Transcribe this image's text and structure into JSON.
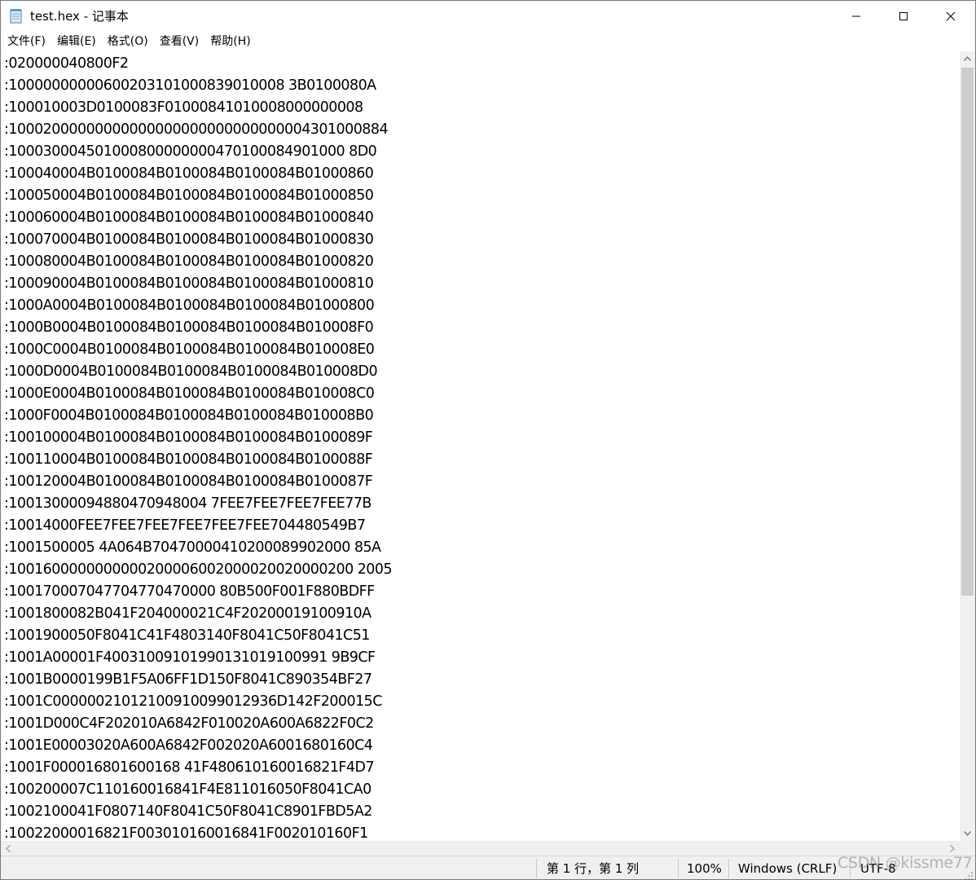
{
  "window": {
    "title": "test.hex - 记事本",
    "minimize_glyph": "—",
    "maximize_glyph": "□",
    "close_glyph": "✕"
  },
  "menu": {
    "items": [
      {
        "label": "文件(F)"
      },
      {
        "label": "编辑(E)"
      },
      {
        "label": "格式(O)"
      },
      {
        "label": "查看(V)"
      },
      {
        "label": "帮助(H)"
      }
    ]
  },
  "editor": {
    "lines": [
      ":020000040800F2",
      ":10000000000600203101000839010008 3B0100080A",
      ":100010003D0100083F01000841010008000000008",
      ":10002000000000000000000000000000004301000884",
      ":100030004501000800000000470100084901000 8D0",
      ":100040004B0100084B0100084B0100084B01000860",
      ":100050004B0100084B0100084B0100084B01000850",
      ":100060004B0100084B0100084B0100084B01000840",
      ":100070004B0100084B0100084B0100084B01000830",
      ":100080004B0100084B0100084B0100084B01000820",
      ":100090004B0100084B0100084B0100084B01000810",
      ":1000A0004B0100084B0100084B0100084B01000800",
      ":1000B0004B0100084B0100084B0100084B010008F0",
      ":1000C0004B0100084B0100084B0100084B010008E0",
      ":1000D0004B0100084B0100084B0100084B010008D0",
      ":1000E0004B0100084B0100084B0100084B010008C0",
      ":1000F0004B0100084B0100084B0100084B010008B0",
      ":100100004B0100084B0100084B0100084B0100089F",
      ":100110004B0100084B0100084B0100084B0100088F",
      ":100120004B0100084B0100084B0100084B0100087F",
      ":10013000094880470948004 7FEE7FEE7FEE7FEE77B",
      ":10014000FEE7FEE7FEE7FEE7FEE7FEE704480549B7",
      ":1001500005 4A064B70470000410200089902000 85A",
      ":1001600000000000200006002000020020000200 2005",
      ":100170007047704770470000 80B500F001F880BDFF",
      ":1001800082B041F204000021C4F20200019100910A",
      ":1001900050F8041C41F4803140F8041C50F8041C51",
      ":1001A00001F40031009101990131019100991 9B9CF",
      ":1001B0000199B1F5A06FF1D150F8041C890354BF27",
      ":1001C00000021012100910099012936D142F200015C",
      ":1001D000C4F202010A6842F010020A600A6822F0C2",
      ":1001E00003020A600A6842F002020A6001680160C4",
      ":1001F000016801600168 41F480610160016821F4D7",
      ":100200007C110160016841F4E811016050F8041CA0",
      ":1002100041F0807140F8041C50F8041C8901FBD5A2",
      ":10022000016821F003010160016841F002010160F1"
    ]
  },
  "status": {
    "position": "第 1 行，第 1 列",
    "zoom": "100%",
    "line_ending": "Windows (CRLF)",
    "encoding": "UTF-8"
  },
  "watermark": "CSDN @kissme77"
}
